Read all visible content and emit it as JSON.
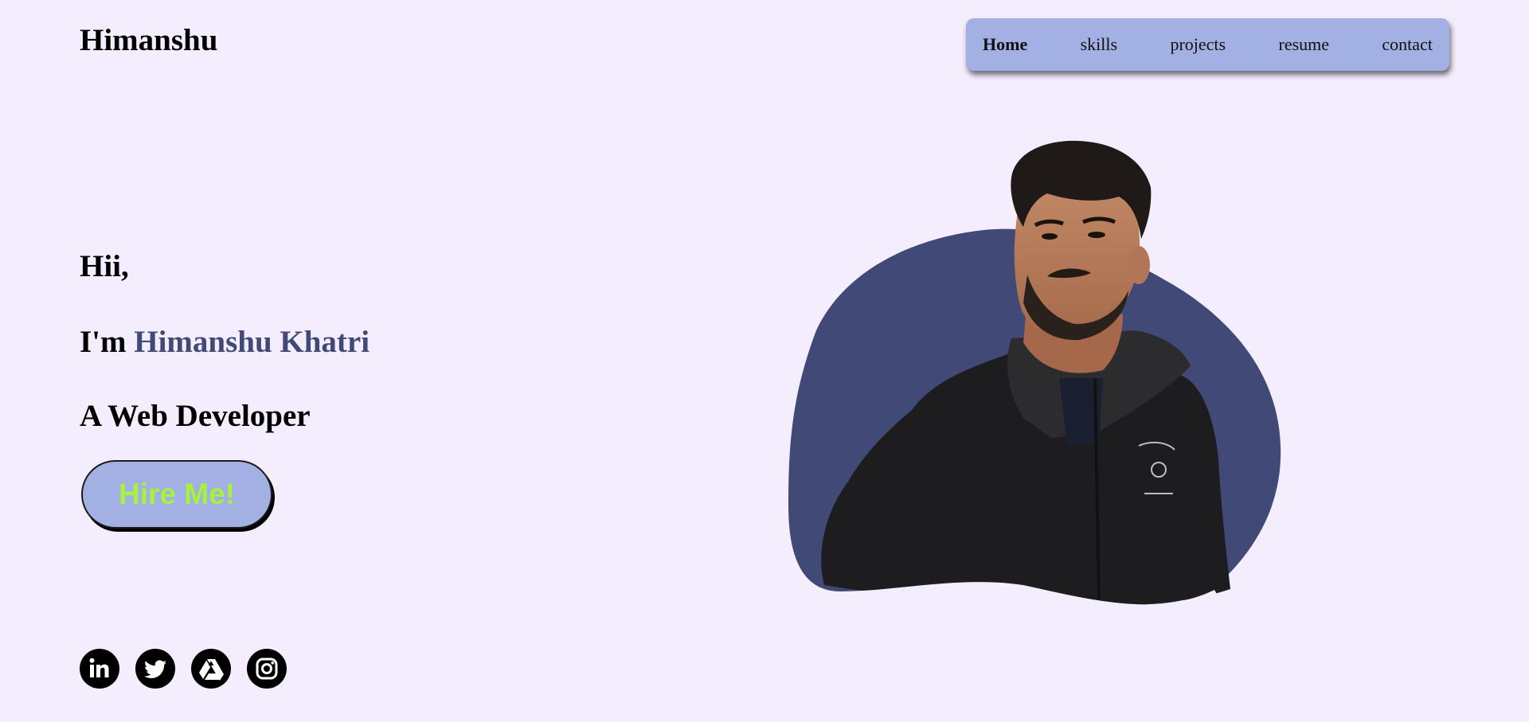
{
  "header": {
    "logo": "Himanshu"
  },
  "nav": {
    "items": [
      {
        "label": "Home",
        "active": true
      },
      {
        "label": "skills",
        "active": false
      },
      {
        "label": "projects",
        "active": false
      },
      {
        "label": "resume",
        "active": false
      },
      {
        "label": "contact",
        "active": false
      }
    ]
  },
  "hero": {
    "greeting": "Hii,",
    "intro_prefix": "I'm ",
    "name": "Himanshu Khatri",
    "role": "A Web Developer",
    "cta_label": "Hire Me!"
  },
  "socials": [
    {
      "icon": "linkedin-icon"
    },
    {
      "icon": "twitter-icon"
    },
    {
      "icon": "google-drive-icon"
    },
    {
      "icon": "instagram-icon"
    }
  ],
  "colors": {
    "background": "#f4edfe",
    "nav_background": "#a3b0e3",
    "accent": "#414a76",
    "cta_text": "#a6f23c",
    "blob": "#414a76"
  }
}
